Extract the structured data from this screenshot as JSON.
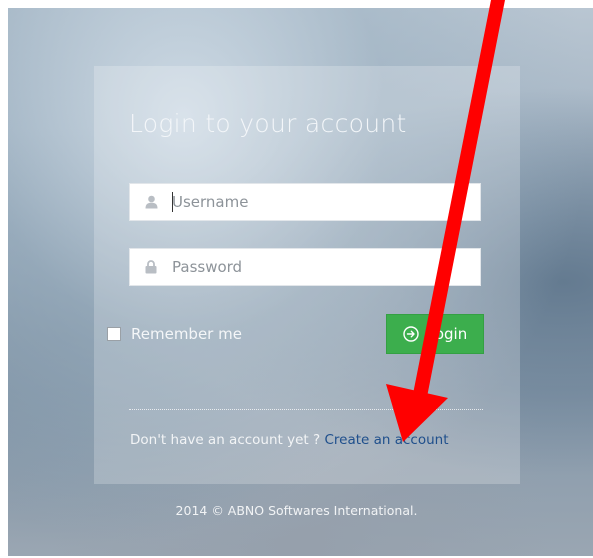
{
  "login": {
    "title": "Login to your account",
    "username_placeholder": "Username",
    "password_placeholder": "Password",
    "remember_label": "Remember me",
    "login_button": "Login",
    "signup_prompt": "Don't have an account yet ?",
    "signup_link": "Create an account"
  },
  "footer": {
    "text": "2014 © ABNO Softwares International."
  },
  "icons": {
    "username": "user-icon",
    "password": "lock-icon",
    "login": "arrow-circle-right-icon"
  },
  "colors": {
    "login_button": "#3cae4d",
    "link": "#1f4f8c",
    "annotation_arrow": "#ff0000"
  }
}
